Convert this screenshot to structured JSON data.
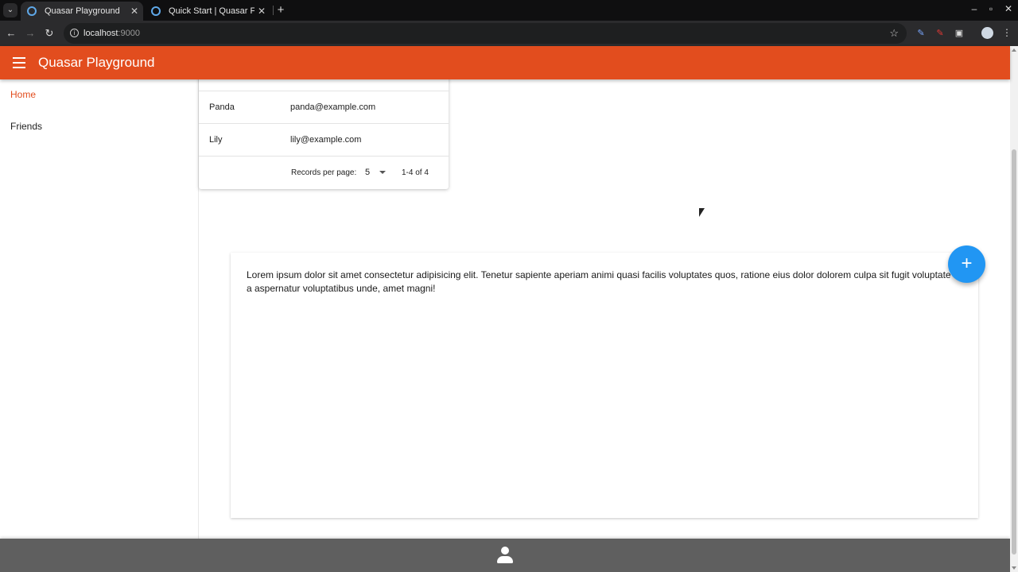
{
  "browser": {
    "tabs": [
      {
        "title": "Quasar Playground",
        "active": true
      },
      {
        "title": "Quick Start | Quasar Framework",
        "active": false
      }
    ],
    "new_tab_icon": "+",
    "url_host": "localhost",
    "url_port": ":9000",
    "window_controls": [
      "–",
      "▫",
      "✕"
    ]
  },
  "app": {
    "title": "Quasar Playground",
    "accent_color": "#e24d1e",
    "footer_color": "#5f5f5f"
  },
  "drawer": {
    "items": [
      {
        "label": "Home",
        "active": true
      },
      {
        "label": "Friends",
        "active": false
      }
    ]
  },
  "table": {
    "rows": [
      {
        "name": "Panda",
        "email": "panda@example.com"
      },
      {
        "name": "Lily",
        "email": "lily@example.com"
      }
    ],
    "footer": {
      "records_per_page_label": "Records per page:",
      "records_per_page_value": "5",
      "pagination": "1-4 of 4"
    }
  },
  "content": {
    "text": "Lorem ipsum dolor sit amet consectetur adipisicing elit. Tenetur sapiente aperiam animi quasi facilis voluptates quos, ratione eius dolor dolorem culpa sit fugit voluptate a aspernatur voluptatibus unde, amet magni!"
  },
  "fab": {
    "icon": "+",
    "color": "#2196f3"
  },
  "footer": {
    "icon": "person-icon"
  }
}
